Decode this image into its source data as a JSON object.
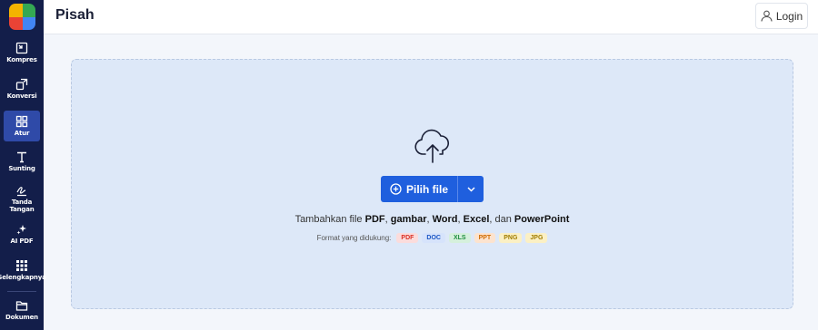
{
  "header": {
    "title": "Pisah",
    "login_label": "Login"
  },
  "sidebar": {
    "logo_colors": [
      "#f4b400",
      "#34a853",
      "#ea4335",
      "#4285f4"
    ],
    "items": [
      {
        "label": "Kompres",
        "icon": "compress-icon"
      },
      {
        "label": "Konversi",
        "icon": "convert-icon"
      },
      {
        "label": "Atur",
        "icon": "grid-icon",
        "active": true
      },
      {
        "label": "Sunting",
        "icon": "text-edit-icon"
      },
      {
        "label": "Tanda",
        "label2": "Tangan",
        "icon": "signature-icon"
      },
      {
        "label": "AI PDF",
        "icon": "sparkle-icon"
      },
      {
        "label": "Selengkapnya",
        "icon": "more-grid-icon"
      },
      {
        "label": "Dokumen",
        "icon": "folder-icon"
      }
    ]
  },
  "main": {
    "pick_button_label": "Pilih file",
    "add_text": {
      "prefix": "Tambahkan file ",
      "pdf": "PDF",
      "comma1": ", ",
      "gambar": "gambar",
      "comma2": ", ",
      "word": "Word",
      "comma3": ", ",
      "excel": "Excel",
      "dan": ", dan ",
      "ppt": "PowerPoint"
    },
    "formats_label": "Format yang didukung:",
    "formats": [
      {
        "label": "PDF",
        "color": "#d93025",
        "bg": "#fbdcdc"
      },
      {
        "label": "DOC",
        "color": "#1a56c4",
        "bg": "#d6e3fb"
      },
      {
        "label": "XLS",
        "color": "#1e8e3e",
        "bg": "#d5f0dc"
      },
      {
        "label": "PPT",
        "color": "#d06b00",
        "bg": "#fce3cf"
      },
      {
        "label": "PNG",
        "color": "#a07c00",
        "bg": "#fbf0c4"
      },
      {
        "label": "JPG",
        "color": "#a07c00",
        "bg": "#fbf0c4"
      }
    ]
  }
}
